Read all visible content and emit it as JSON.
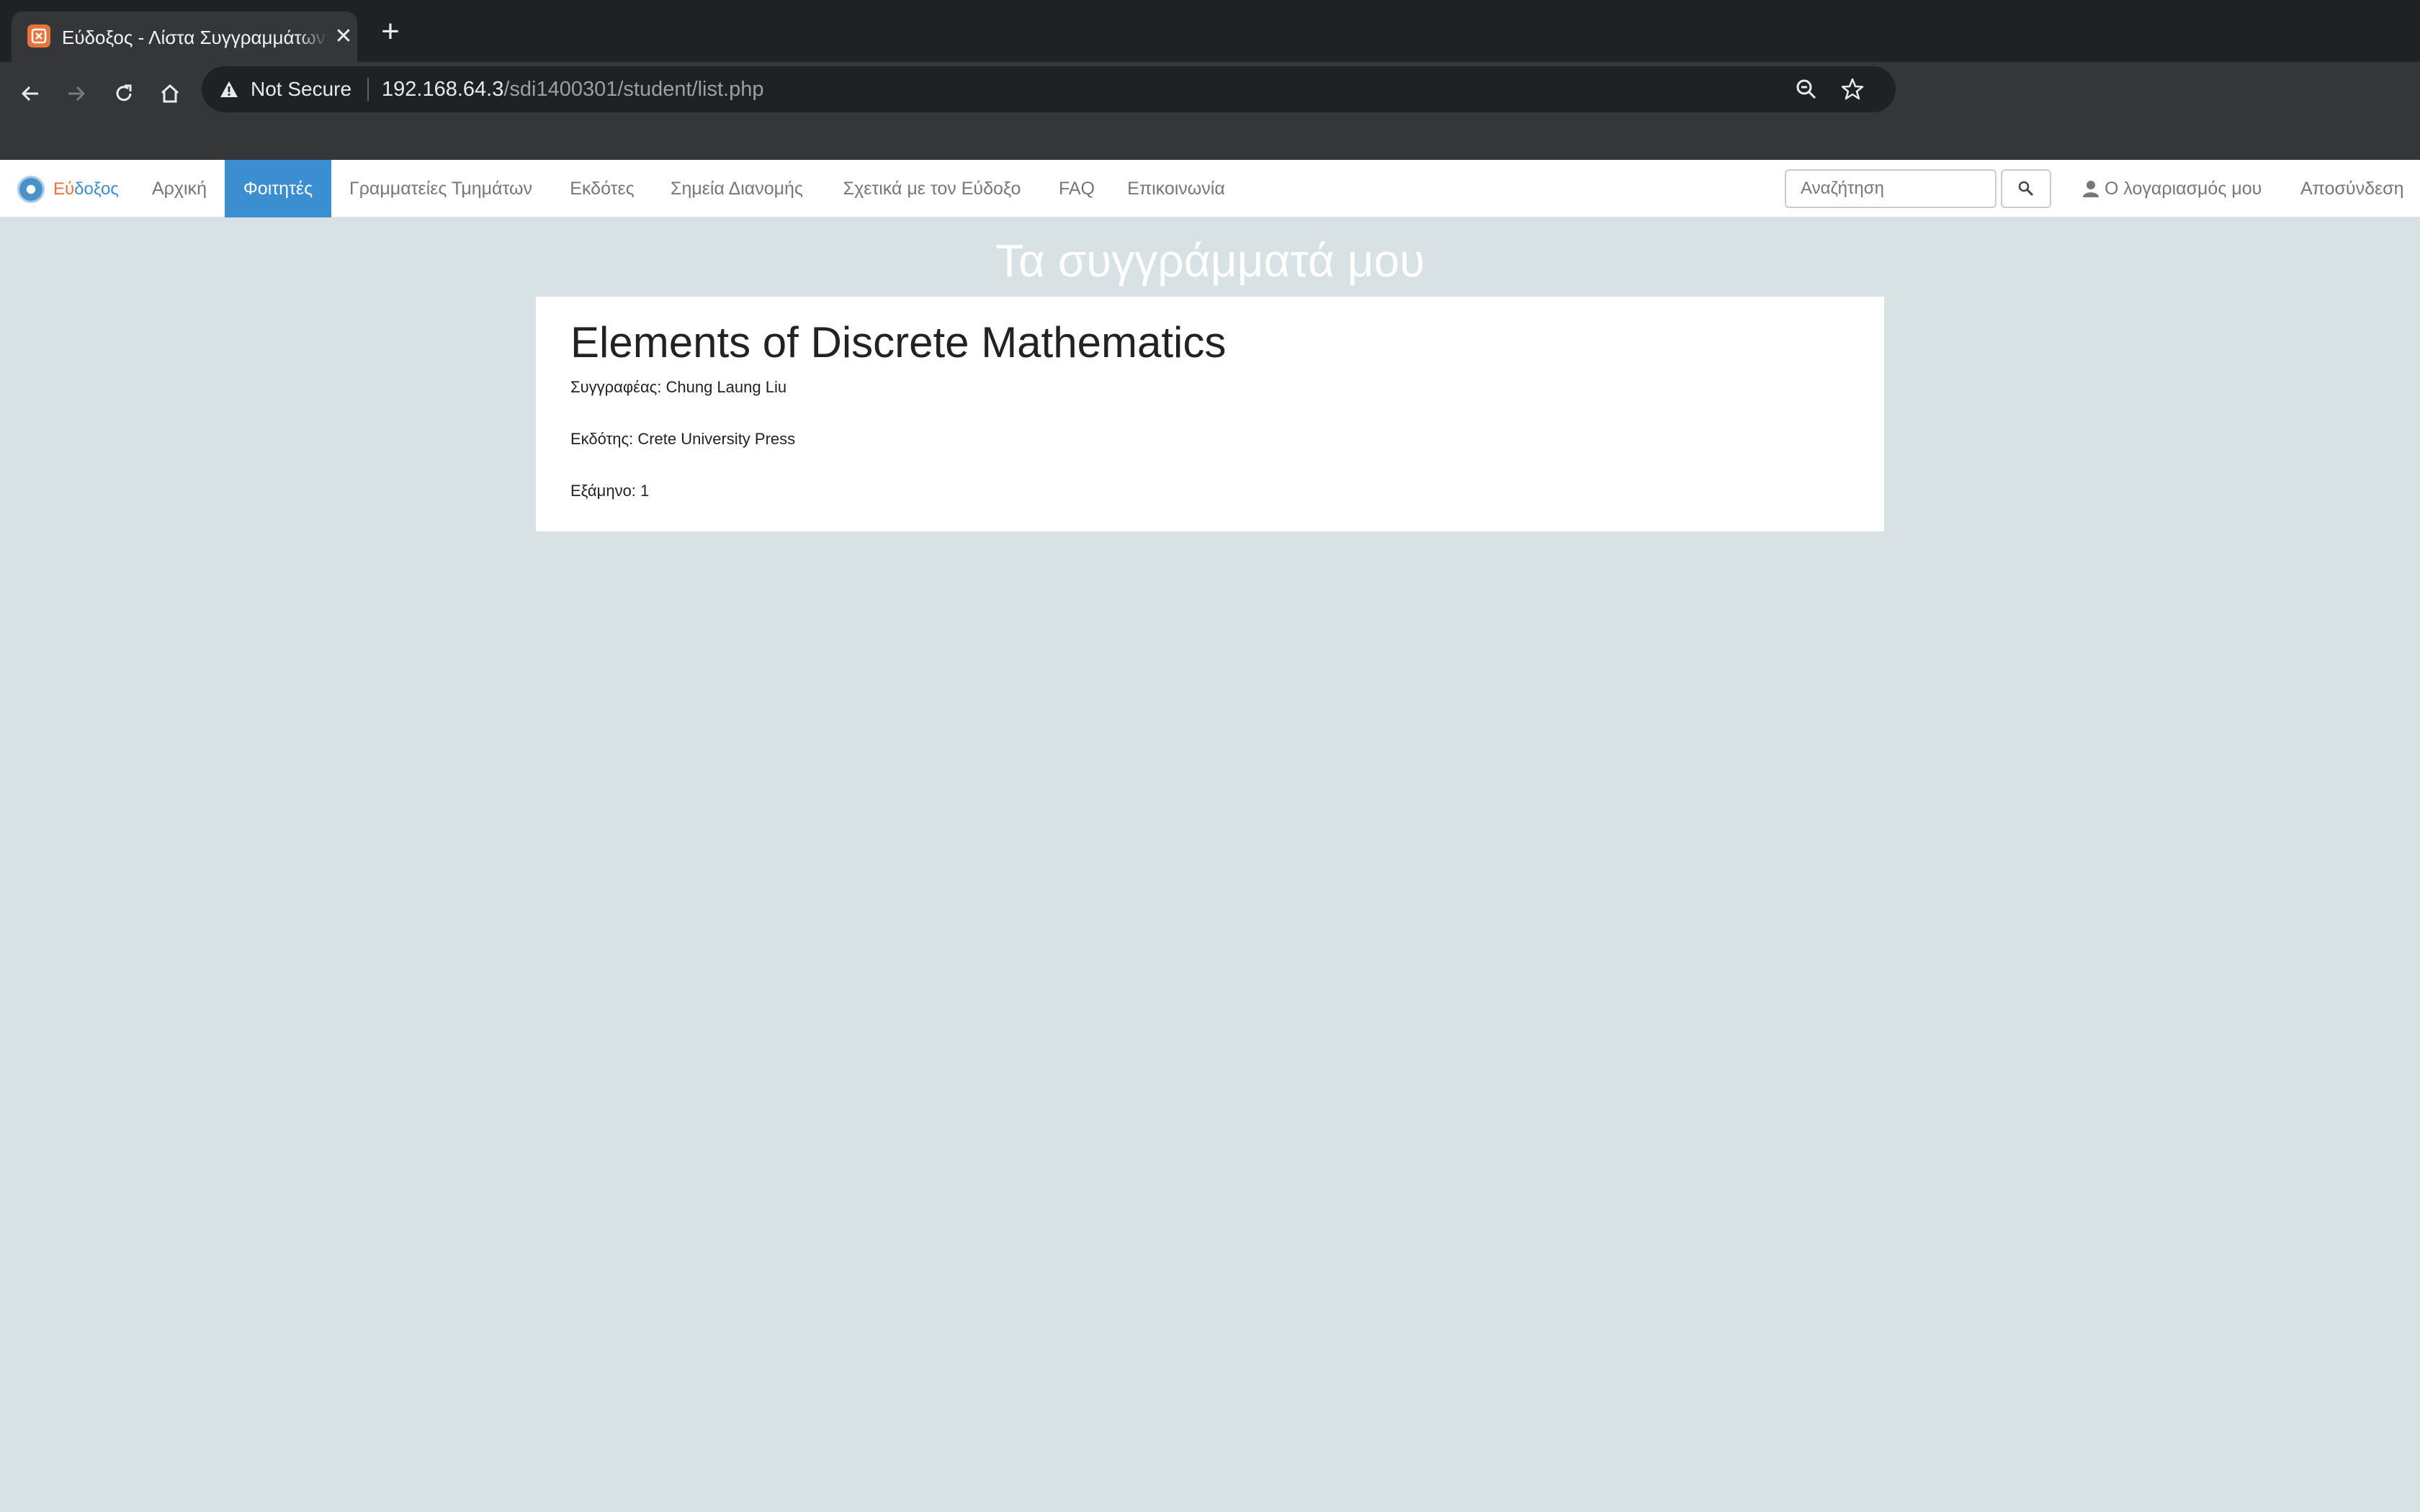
{
  "browser": {
    "tab_title": "Εύδοξος - Λίστα Συγγραμμάτων",
    "security_label": "Not Secure",
    "url_host": "192.168.64.3",
    "url_path": "/sdi1400301/student/list.php"
  },
  "navbar": {
    "brand_a": "Εύ",
    "brand_b": "δοξος",
    "items": [
      {
        "label": "Αρχική",
        "active": false
      },
      {
        "label": "Φοιτητές",
        "active": true
      },
      {
        "label": "Γραμματείες Τμημάτων",
        "active": false
      },
      {
        "label": "Εκδότες",
        "active": false
      },
      {
        "label": "Σημεία Διανομής",
        "active": false
      },
      {
        "label": "Σχετικά με τον Εύδοξο",
        "active": false
      },
      {
        "label": "FAQ",
        "active": false
      },
      {
        "label": "Επικοινωνία",
        "active": false
      }
    ],
    "search_placeholder": "Αναζήτηση",
    "account_label": "Ο λογαριασμός μου",
    "logout_label": "Αποσύνδεση"
  },
  "main": {
    "heading": "Τα συγγράμματά μου",
    "book": {
      "title": "Elements of Discrete Mathematics",
      "author_line": "Συγγραφέας: Chung Laung Liu",
      "publisher_line": "Εκδότης: Crete University Press",
      "semester_line": "Εξάμηνο: 1"
    }
  },
  "colors": {
    "accent": "#3b8fd0",
    "page_background": "#d8e1e4",
    "brand_orange": "#e8743b"
  }
}
